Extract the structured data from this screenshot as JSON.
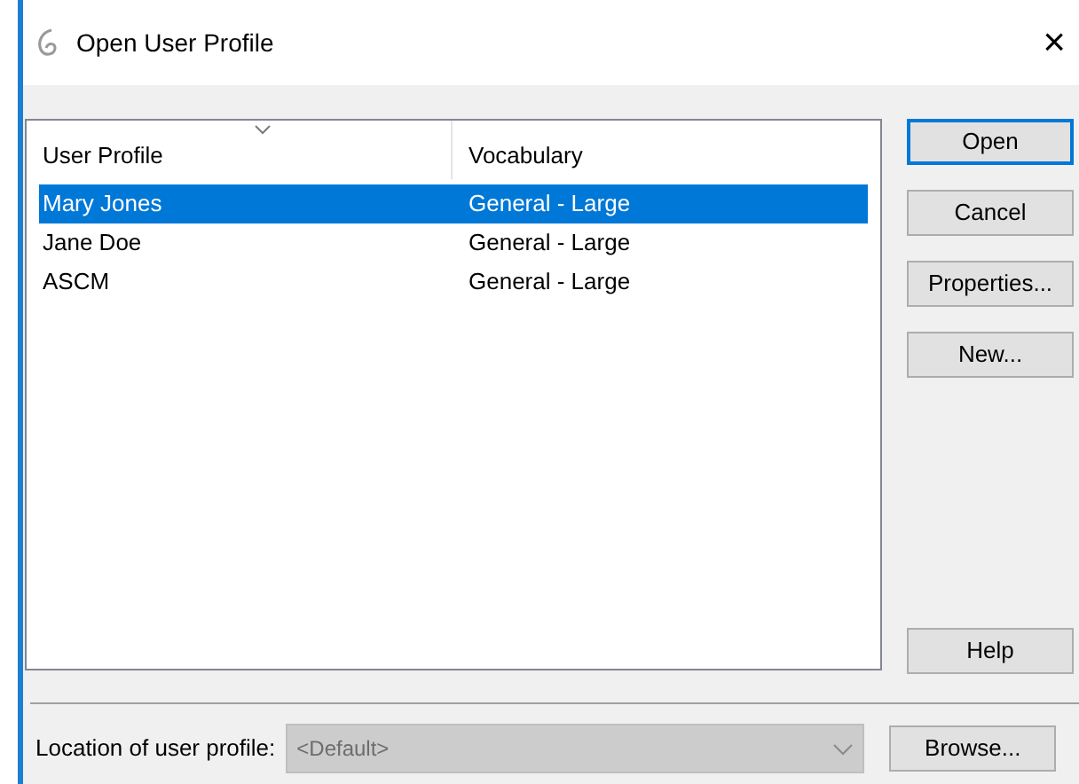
{
  "window": {
    "title": "Open User Profile",
    "close": "×"
  },
  "table": {
    "columns": [
      {
        "label": "User Profile",
        "sorted": true
      },
      {
        "label": "Vocabulary",
        "sorted": false
      }
    ],
    "rows": [
      {
        "cells": [
          "Mary Jones",
          "General - Large"
        ],
        "selected": true
      },
      {
        "cells": [
          "Jane Doe",
          "General - Large"
        ],
        "selected": false
      },
      {
        "cells": [
          "ASCM",
          "General - Large"
        ],
        "selected": false
      }
    ]
  },
  "buttons": [
    {
      "label": "Open",
      "default": true
    },
    {
      "label": "Cancel",
      "default": false
    },
    {
      "label": "Properties...",
      "default": false
    },
    {
      "label": "New...",
      "default": false
    }
  ],
  "help_button": "Help",
  "location": {
    "label": "Location of user profile:",
    "value": "<Default>",
    "disabled": true
  },
  "browse_button": "Browse..."
}
